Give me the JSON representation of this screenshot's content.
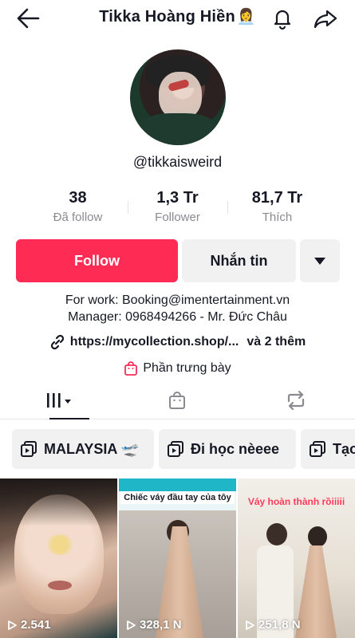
{
  "header": {
    "title": "Tikka Hoàng Hiền",
    "title_emoji": "👩‍💼",
    "back_icon": "arrow-left-icon",
    "bell_icon": "bell-icon",
    "share_icon": "share-arrow-icon"
  },
  "profile": {
    "handle": "@tikkaisweird",
    "stats": [
      {
        "value": "38",
        "label": "Đã follow"
      },
      {
        "value": "1,3 Tr",
        "label": "Follower"
      },
      {
        "value": "81,7 Tr",
        "label": "Thích"
      }
    ],
    "follow_label": "Follow",
    "message_label": "Nhắn tin",
    "bio_line1": "For work: Booking@imentertainment.vn",
    "bio_line2": "Manager: 0968494266 - Mr. Đức Châu",
    "link_text": "https://mycollection.shop/...",
    "link_extra": "và 2 thêm",
    "showcase_label": "Phần trưng bày"
  },
  "colors": {
    "accent": "#fe2c55",
    "button_bg": "#f1f1f2",
    "text": "#161823",
    "muted": "#8a8b91"
  },
  "tabs": [
    {
      "icon": "grid-icon",
      "active": true
    },
    {
      "icon": "shopping-bag-icon",
      "active": false
    },
    {
      "icon": "repost-icon",
      "active": false
    }
  ],
  "playlists": [
    {
      "label": "MALAYSIA 🛫"
    },
    {
      "label": "Đi học nèeee"
    },
    {
      "label": "Tạo"
    }
  ],
  "videos": [
    {
      "views": "2.541",
      "caption": ""
    },
    {
      "views": "328,1 N",
      "caption": "Chiếc váy đầu tay của tôy"
    },
    {
      "views": "251,8 N",
      "caption": "Váy hoàn thành rồiiiii"
    }
  ]
}
